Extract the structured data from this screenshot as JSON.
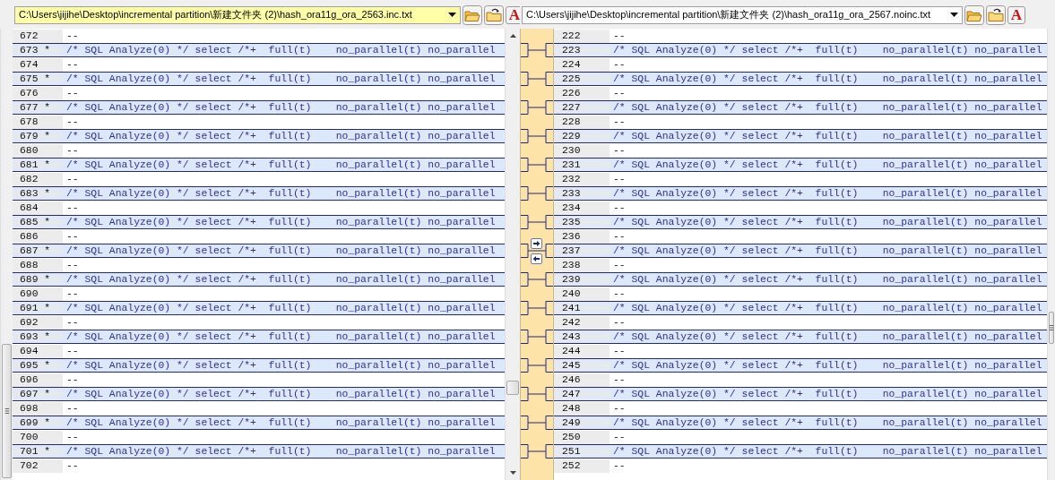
{
  "left_file": {
    "path": "C:\\Users\\jijihe\\Desktop\\incremental partition\\新建文件夹 (2)\\hash_ora11g_ora_2563.inc.txt",
    "font_button": "A"
  },
  "right_file": {
    "path": "C:\\Users\\jijihe\\Desktop\\incremental partition\\新建文件夹 (2)\\hash_ora11g_ora_2567.noinc.txt",
    "font_button": "A"
  },
  "left_lines": [
    {
      "number": "672",
      "text": "--",
      "changed": false
    },
    {
      "number": "673",
      "marker": "*",
      "text": "/* SQL Analyze(0) */ select /*+  full(t)    no_parallel(t) no_parallel",
      "changed": true
    },
    {
      "number": "674",
      "text": "--",
      "changed": false
    },
    {
      "number": "675",
      "marker": "*",
      "text": "/* SQL Analyze(0) */ select /*+  full(t)    no_parallel(t) no_parallel",
      "changed": true
    },
    {
      "number": "676",
      "text": "--",
      "changed": false
    },
    {
      "number": "677",
      "marker": "*",
      "text": "/* SQL Analyze(0) */ select /*+  full(t)    no_parallel(t) no_parallel",
      "changed": true
    },
    {
      "number": "678",
      "text": "--",
      "changed": false
    },
    {
      "number": "679",
      "marker": "*",
      "text": "/* SQL Analyze(0) */ select /*+  full(t)    no_parallel(t) no_parallel",
      "changed": true
    },
    {
      "number": "680",
      "text": "--",
      "changed": false
    },
    {
      "number": "681",
      "marker": "*",
      "text": "/* SQL Analyze(0) */ select /*+  full(t)    no_parallel(t) no_parallel",
      "changed": true
    },
    {
      "number": "682",
      "text": "--",
      "changed": false
    },
    {
      "number": "683",
      "marker": "*",
      "text": "/* SQL Analyze(0) */ select /*+  full(t)    no_parallel(t) no_parallel",
      "changed": true
    },
    {
      "number": "684",
      "text": "--",
      "changed": false
    },
    {
      "number": "685",
      "marker": "*",
      "text": "/* SQL Analyze(0) */ select /*+  full(t)    no_parallel(t) no_parallel",
      "changed": true
    },
    {
      "number": "686",
      "text": "--",
      "changed": false
    },
    {
      "number": "687",
      "marker": "*",
      "text": "/* SQL Analyze(0) */ select /*+  full(t)    no_parallel(t) no_parallel",
      "changed": true
    },
    {
      "number": "688",
      "text": "--",
      "changed": false
    },
    {
      "number": "689",
      "marker": "*",
      "text": "/* SQL Analyze(0) */ select /*+  full(t)    no_parallel(t) no_parallel",
      "changed": true
    },
    {
      "number": "690",
      "text": "--",
      "changed": false
    },
    {
      "number": "691",
      "marker": "*",
      "text": "/* SQL Analyze(0) */ select /*+  full(t)    no_parallel(t) no_parallel",
      "changed": true
    },
    {
      "number": "692",
      "text": "--",
      "changed": false
    },
    {
      "number": "693",
      "marker": "*",
      "text": "/* SQL Analyze(0) */ select /*+  full(t)    no_parallel(t) no_parallel",
      "changed": true
    },
    {
      "number": "694",
      "text": "--",
      "changed": false
    },
    {
      "number": "695",
      "marker": "*",
      "text": "/* SQL Analyze(0) */ select /*+  full(t)    no_parallel(t) no_parallel",
      "changed": true
    },
    {
      "number": "696",
      "text": "--",
      "changed": false
    },
    {
      "number": "697",
      "marker": "*",
      "text": "/* SQL Analyze(0) */ select /*+  full(t)    no_parallel(t) no_parallel",
      "changed": true
    },
    {
      "number": "698",
      "text": "--",
      "changed": false
    },
    {
      "number": "699",
      "marker": "*",
      "text": "/* SQL Analyze(0) */ select /*+  full(t)    no_parallel(t) no_parallel",
      "changed": true
    },
    {
      "number": "700",
      "text": "--",
      "changed": false
    },
    {
      "number": "701",
      "marker": "*",
      "text": "/* SQL Analyze(0) */ select /*+  full(t)    no_parallel(t) no_parallel",
      "changed": true
    },
    {
      "number": "702",
      "text": "--",
      "changed": false
    }
  ],
  "right_lines": [
    {
      "number": "222",
      "text": "--",
      "changed": false
    },
    {
      "number": "223",
      "text": "/* SQL Analyze(0) */ select /*+  full(t)    no_parallel(t) no_parallel",
      "changed": true
    },
    {
      "number": "224",
      "text": "--",
      "changed": false
    },
    {
      "number": "225",
      "text": "/* SQL Analyze(0) */ select /*+  full(t)    no_parallel(t) no_parallel",
      "changed": true
    },
    {
      "number": "226",
      "text": "--",
      "changed": false
    },
    {
      "number": "227",
      "text": "/* SQL Analyze(0) */ select /*+  full(t)    no_parallel(t) no_parallel",
      "changed": true
    },
    {
      "number": "228",
      "text": "--",
      "changed": false
    },
    {
      "number": "229",
      "text": "/* SQL Analyze(0) */ select /*+  full(t)    no_parallel(t) no_parallel",
      "changed": true
    },
    {
      "number": "230",
      "text": "--",
      "changed": false
    },
    {
      "number": "231",
      "text": "/* SQL Analyze(0) */ select /*+  full(t)    no_parallel(t) no_parallel",
      "changed": true
    },
    {
      "number": "232",
      "text": "--",
      "changed": false
    },
    {
      "number": "233",
      "text": "/* SQL Analyze(0) */ select /*+  full(t)    no_parallel(t) no_parallel",
      "changed": true
    },
    {
      "number": "234",
      "text": "--",
      "changed": false
    },
    {
      "number": "235",
      "text": "/* SQL Analyze(0) */ select /*+  full(t)    no_parallel(t) no_parallel",
      "changed": true
    },
    {
      "number": "236",
      "text": "--",
      "changed": false
    },
    {
      "number": "237",
      "text": "/* SQL Analyze(0) */ select /*+  full(t)    no_parallel(t) no_parallel",
      "changed": true
    },
    {
      "number": "238",
      "text": "--",
      "changed": false
    },
    {
      "number": "239",
      "text": "/* SQL Analyze(0) */ select /*+  full(t)    no_parallel(t) no_parallel",
      "changed": true
    },
    {
      "number": "240",
      "text": "--",
      "changed": false
    },
    {
      "number": "241",
      "text": "/* SQL Analyze(0) */ select /*+  full(t)    no_parallel(t) no_parallel",
      "changed": true
    },
    {
      "number": "242",
      "text": "--",
      "changed": false
    },
    {
      "number": "243",
      "text": "/* SQL Analyze(0) */ select /*+  full(t)    no_parallel(t) no_parallel",
      "changed": true
    },
    {
      "number": "244",
      "text": "--",
      "changed": false
    },
    {
      "number": "245",
      "text": "/* SQL Analyze(0) */ select /*+  full(t)    no_parallel(t) no_parallel",
      "changed": true
    },
    {
      "number": "246",
      "text": "--",
      "changed": false
    },
    {
      "number": "247",
      "text": "/* SQL Analyze(0) */ select /*+  full(t)    no_parallel(t) no_parallel",
      "changed": true
    },
    {
      "number": "248",
      "text": "--",
      "changed": false
    },
    {
      "number": "249",
      "text": "/* SQL Analyze(0) */ select /*+  full(t)    no_parallel(t) no_parallel",
      "changed": true
    },
    {
      "number": "250",
      "text": "--",
      "changed": false
    },
    {
      "number": "251",
      "text": "/* SQL Analyze(0) */ select /*+  full(t)    no_parallel(t) no_parallel",
      "changed": true
    },
    {
      "number": "252",
      "text": "--",
      "changed": false
    }
  ]
}
